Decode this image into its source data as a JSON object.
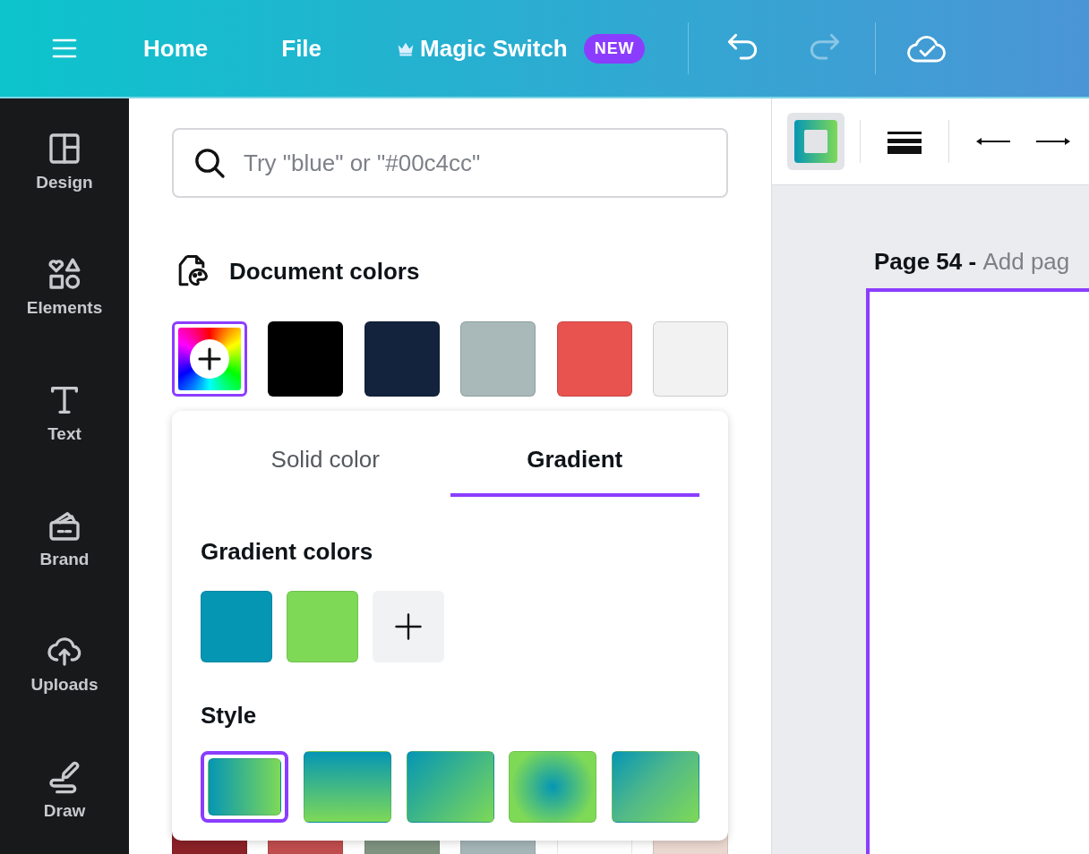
{
  "top_bar": {
    "menu_items": [
      {
        "label": "Home"
      },
      {
        "label": "File"
      }
    ],
    "magic_switch": {
      "label": "Magic Switch",
      "badge": "NEW"
    },
    "undo": {
      "disabled": false
    },
    "redo": {
      "disabled": true
    }
  },
  "sidebar": {
    "items": [
      {
        "kind": "design",
        "label": "Design"
      },
      {
        "kind": "elements",
        "label": "Elements"
      },
      {
        "kind": "text",
        "label": "Text"
      },
      {
        "kind": "brand",
        "label": "Brand"
      },
      {
        "kind": "uploads",
        "label": "Uploads"
      },
      {
        "kind": "draw",
        "label": "Draw"
      }
    ]
  },
  "color_panel": {
    "search": {
      "placeholder": "Try \"blue\" or \"#00c4cc\""
    },
    "document_colors": {
      "title": "Document colors",
      "add_swatch": {
        "selected": true
      },
      "swatches": [
        {
          "color": "#000000",
          "selected": false
        },
        {
          "color": "#13223d",
          "selected": false
        },
        {
          "color": "#a9b9ba",
          "selected": false
        },
        {
          "color": "#e9534f",
          "selected": false
        },
        {
          "color": "#f2f2f2",
          "selected": false
        }
      ],
      "more_swatches": [
        {
          "color": "#8b2228"
        },
        {
          "color": "#c04d4e"
        },
        {
          "color": "#7f9380"
        },
        {
          "color": "#a5b5b8"
        },
        {
          "color": "#ffffff"
        },
        {
          "color": "#ead7d0"
        }
      ]
    },
    "picker": {
      "tabs": [
        {
          "label": "Solid color",
          "selected": false
        },
        {
          "label": "Gradient",
          "selected": true
        }
      ],
      "gradient_colors": {
        "title": "Gradient colors",
        "colors": [
          {
            "color": "#0596b4"
          },
          {
            "color": "#7ed957"
          }
        ]
      },
      "style": {
        "title": "Style",
        "options": [
          {
            "kind": "horizontal",
            "selected": true
          },
          {
            "kind": "vertical",
            "selected": false
          },
          {
            "kind": "diagonal",
            "selected": false
          },
          {
            "kind": "radial",
            "selected": false
          },
          {
            "kind": "diagonal-reverse",
            "selected": false
          }
        ]
      }
    }
  },
  "editor": {
    "toolbar": {
      "gradient_button": {
        "selected": true
      }
    },
    "page": {
      "title": "Page 54 - ",
      "subtitle": "Add pag"
    }
  }
}
